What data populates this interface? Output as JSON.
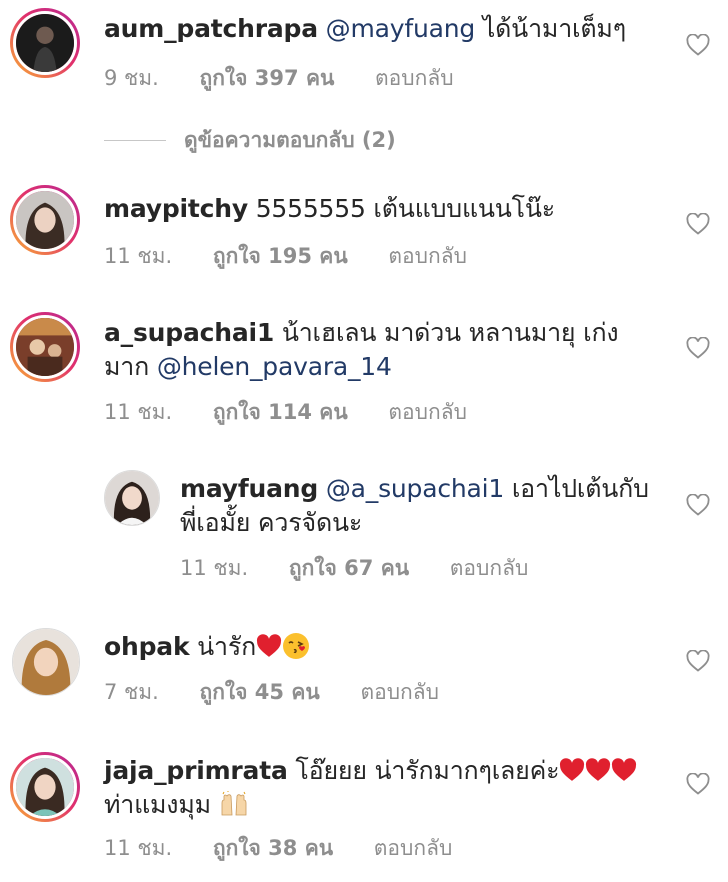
{
  "comments": [
    {
      "username": "aum_patchrapa",
      "mention": "@mayfuang",
      "text": " ได้น้ามาเต็มๆ",
      "time": "9 ชม.",
      "likes": "ถูกใจ 397 คน",
      "reply": "ตอบกลับ"
    },
    {
      "username": "maypitchy",
      "text": " 5555555 เต้นแบบแนนโน๊ะ",
      "time": "11 ชม.",
      "likes": "ถูกใจ 195 คน",
      "reply": "ตอบกลับ"
    },
    {
      "username": "a_supachai1",
      "text": " น้าเฮเลน มาด่วน หลานมายุ เก่ง มาก ",
      "mention": "@helen_pavara_14",
      "time": "11 ชม.",
      "likes": "ถูกใจ 114 คน",
      "reply": "ตอบกลับ"
    },
    {
      "username": "mayfuang",
      "mention": "@a_supachai1",
      "text": " เอาไปเต้นกับพี่เอมั้ย ควรจัดนะ",
      "time": "11 ชม.",
      "likes": "ถูกใจ 67 คน",
      "reply": "ตอบกลับ"
    },
    {
      "username": "ohpak",
      "text": " น่ารัก",
      "time": "7 ชม.",
      "likes": "ถูกใจ 45 คน",
      "reply": "ตอบกลับ"
    },
    {
      "username": "jaja_primrata",
      "text": " โอ๊ยยย น่ารักมากๆเลยค่ะ",
      "text2": "ท่าแมงมุม ",
      "time": "11 ชม.",
      "likes": "ถูกใจ 38 คน",
      "reply": "ตอบกลับ"
    }
  ],
  "view_replies": "ดูข้อความตอบกลับ (2)",
  "icons": {
    "like": "heart-outline-icon",
    "emoji_heart": "red-heart-emoji",
    "emoji_kiss": "face-blowing-kiss-emoji",
    "emoji_hands": "raising-hands-emoji"
  },
  "colors": {
    "username": "#262626",
    "mention": "#223a66",
    "meta": "#8e8e8e",
    "emoji_heart": "#e0202e"
  }
}
